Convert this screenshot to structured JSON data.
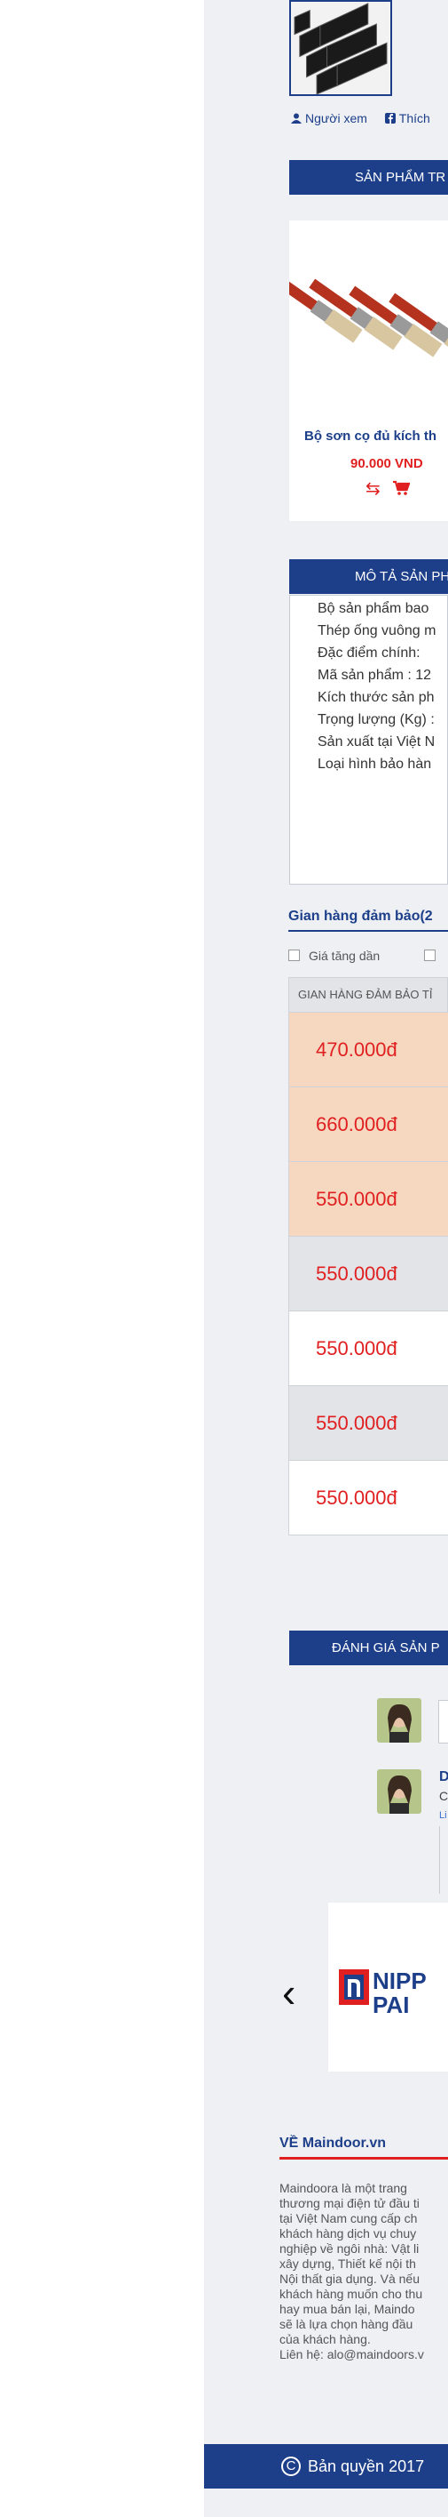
{
  "meta": {
    "viewers_label": "Người xem",
    "like_label": "Thích"
  },
  "related": {
    "title": "SẢN PHẨM TR",
    "product": {
      "name": "Bộ sơn cọ đủ kích th",
      "price": "90.000 VND"
    }
  },
  "description": {
    "title": "MÔ TẢ SẢN PH",
    "lines": [
      "Bộ sản phẩm bao",
      "Thép ống vuông m",
      "Đặc điểm chính:",
      "Mã sản phẩm : 12",
      "Kích thước sản ph",
      "Trọng lượng (Kg) :",
      "Sản xuất tại Việt N",
      "Loại hình bảo hàn"
    ]
  },
  "guarantee": {
    "title": "Gian hàng đảm bảo(2",
    "sort": {
      "ascending": "Giá tăng dần",
      "other": ""
    },
    "header": "GIAN HÀNG ĐẢM BẢO TỈ",
    "rows": [
      {
        "price": "470.000đ",
        "bg": "#f6d8c1"
      },
      {
        "price": "660.000đ",
        "bg": "#f6d8c1"
      },
      {
        "price": "550.000đ",
        "bg": "#f6d8c1"
      },
      {
        "price": "550.000đ",
        "bg": "#e3e4e8"
      },
      {
        "price": "550.000đ",
        "bg": "#ffffff"
      },
      {
        "price": "550.000đ",
        "bg": "#e3e4e8"
      },
      {
        "price": "550.000đ",
        "bg": "#ffffff"
      }
    ]
  },
  "reviews": {
    "title": "ĐÁNH GIÁ SẢN P",
    "comment": {
      "author": "D",
      "text": "C",
      "link": "Li"
    }
  },
  "partners": {
    "brand_line1": "NIPP",
    "brand_line2": "PAI"
  },
  "footer": {
    "title": "VỀ Maindoor.vn",
    "about": "Maindoora là một trang\nthương mại điện tử đầu ti\ntại Việt Nam cung cấp ch\nkhách hàng dịch vụ chuy\nnghiệp về ngôi nhà: Vật li\nxây dựng, Thiết kế nội th\nNội thất gia dụng. Và nếu\nkhách hàng muốn cho thu\nhay mua bán lại, Maindo\nsẽ là lựa chọn hàng đầu\ncủa khách hàng.\nLiên hệ: alo@maindoors.v",
    "copyright_symbol": "C",
    "copyright": "Bản quyền 2017"
  },
  "colors": {
    "brand_blue": "#1d3f8a",
    "price_red": "#e02020"
  }
}
